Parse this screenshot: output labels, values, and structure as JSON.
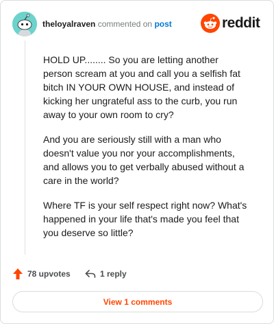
{
  "header": {
    "username": "theloyalraven",
    "action_text": "commented on",
    "post_link": "post",
    "logo_text": "reddit"
  },
  "comment": {
    "paragraphs": [
      "HOLD UP........ So you are letting another person scream at you and call you a selfish fat bitch IN YOUR OWN HOUSE, and instead of kicking her ungrateful ass to the curb, you run away to your own room to cry?",
      "And you are seriously still with a man who doesn't value you nor your accomplishments, and allows you to get verbally abused without a care in the world?",
      "Where TF is your self respect right now? What's happened in your life that's made you feel that you deserve so little?"
    ]
  },
  "actions": {
    "upvotes": "78 upvotes",
    "replies": "1 reply",
    "view_comments": "View 1 comments"
  },
  "colors": {
    "brand": "#ff4500",
    "link": "#0079d3",
    "avatar_bg": "#6dd3cc"
  },
  "icons": [
    "avatar-snoo",
    "reddit-logo-icon",
    "upvote-arrow-icon",
    "reply-arrow-icon"
  ]
}
